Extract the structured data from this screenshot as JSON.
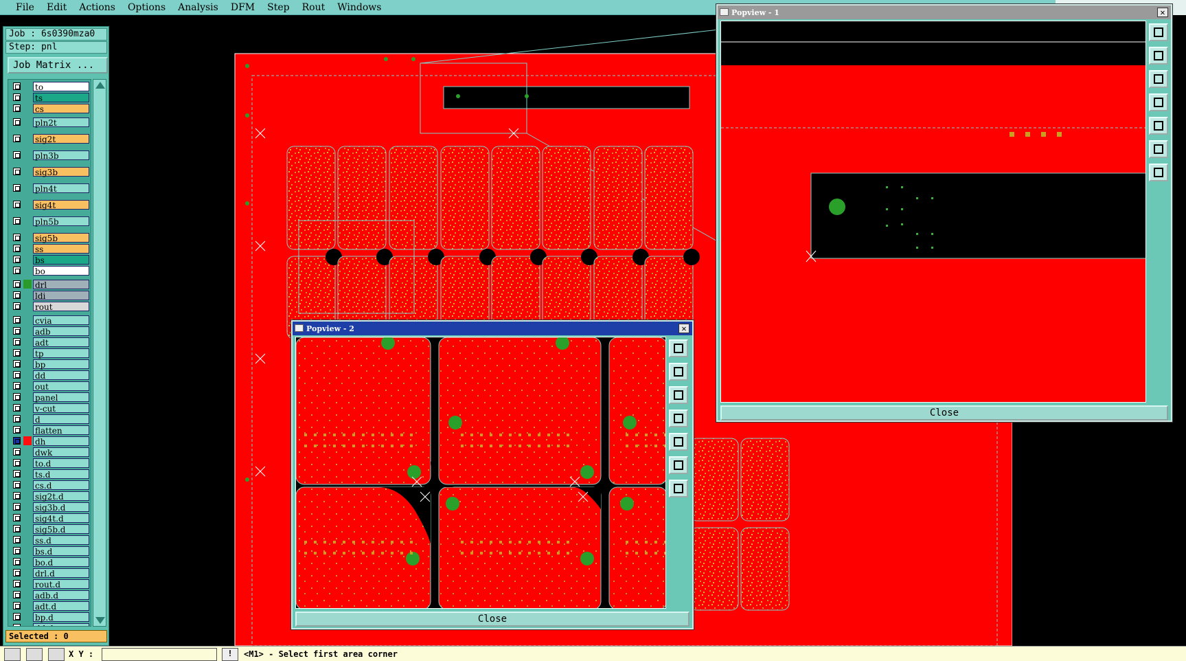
{
  "menu": [
    "File",
    "Edit",
    "Actions",
    "Options",
    "Analysis",
    "DFM",
    "Step",
    "Rout",
    "Windows"
  ],
  "job": {
    "job_label": "Job : 6s0390mza0",
    "step_label": "Step: pnl",
    "matrix_button": "Job Matrix ..."
  },
  "layers": [
    {
      "name": "to",
      "color": "#ffffff"
    },
    {
      "name": "ts",
      "color": "#1aa888"
    },
    {
      "name": "cs",
      "color": "#f8c060"
    },
    {
      "name": "pln2t",
      "color": "#8fdcd0"
    },
    {
      "name": "sig2t",
      "color": "#f8c060"
    },
    {
      "name": "pln3b",
      "color": "#8fdcd0"
    },
    {
      "name": "sig3b",
      "color": "#f8c060"
    },
    {
      "name": "pln4t",
      "color": "#8fdcd0"
    },
    {
      "name": "sig4t",
      "color": "#f8c060"
    },
    {
      "name": "pln5b",
      "color": "#8fdcd0"
    },
    {
      "name": "sig5b",
      "color": "#f8c060"
    },
    {
      "name": "ss",
      "color": "#f8c060"
    },
    {
      "name": "bs",
      "color": "#1aa888"
    },
    {
      "name": "bo",
      "color": "#ffffff"
    },
    {
      "name": "drl",
      "color": "#a0b0b8"
    },
    {
      "name": "ldi",
      "color": "#a0b0b8"
    },
    {
      "name": "rout",
      "color": "#d8d8d8"
    },
    {
      "name": "cvia",
      "color": "#8fdcd0"
    },
    {
      "name": "adb",
      "color": "#8fdcd0"
    },
    {
      "name": "adt",
      "color": "#8fdcd0"
    },
    {
      "name": "tp",
      "color": "#8fdcd0"
    },
    {
      "name": "bp",
      "color": "#8fdcd0"
    },
    {
      "name": "dd",
      "color": "#8fdcd0"
    },
    {
      "name": "out",
      "color": "#8fdcd0"
    },
    {
      "name": "panel",
      "color": "#8fdcd0"
    },
    {
      "name": "v-cut",
      "color": "#8fdcd0"
    },
    {
      "name": "d",
      "color": "#8fdcd0"
    },
    {
      "name": "flatten",
      "color": "#8fdcd0"
    },
    {
      "name": "dh",
      "color": "#8fdcd0"
    },
    {
      "name": "dwk",
      "color": "#8fdcd0"
    },
    {
      "name": "to.d",
      "color": "#8fdcd0"
    },
    {
      "name": "ts.d",
      "color": "#8fdcd0"
    },
    {
      "name": "cs.d",
      "color": "#8fdcd0"
    },
    {
      "name": "sig2t.d",
      "color": "#8fdcd0"
    },
    {
      "name": "sig3b.d",
      "color": "#8fdcd0"
    },
    {
      "name": "sig4t.d",
      "color": "#8fdcd0"
    },
    {
      "name": "sig5b.d",
      "color": "#8fdcd0"
    },
    {
      "name": "ss.d",
      "color": "#8fdcd0"
    },
    {
      "name": "bs.d",
      "color": "#8fdcd0"
    },
    {
      "name": "bo.d",
      "color": "#8fdcd0"
    },
    {
      "name": "drl.d",
      "color": "#8fdcd0"
    },
    {
      "name": "rout.d",
      "color": "#8fdcd0"
    },
    {
      "name": "adb.d",
      "color": "#8fdcd0"
    },
    {
      "name": "adt.d",
      "color": "#8fdcd0"
    },
    {
      "name": "bp.d",
      "color": "#8fdcd0"
    },
    {
      "name": "dd.d",
      "color": "#8fdcd0"
    }
  ],
  "selected_label": "Selected : 0",
  "popview1": {
    "title": "Popview - 1",
    "close": "Close"
  },
  "popview2": {
    "title": "Popview - 2",
    "close": "Close"
  },
  "status": {
    "xy_label": "X Y :",
    "xy_value": "",
    "prompt": "<M1> - Select first area corner",
    "warn_label": "!"
  },
  "colors": {
    "board": "#ff0000",
    "outline": "#7fd0c8",
    "pad": "#2a9a2a",
    "trace": "#c89a2a"
  }
}
